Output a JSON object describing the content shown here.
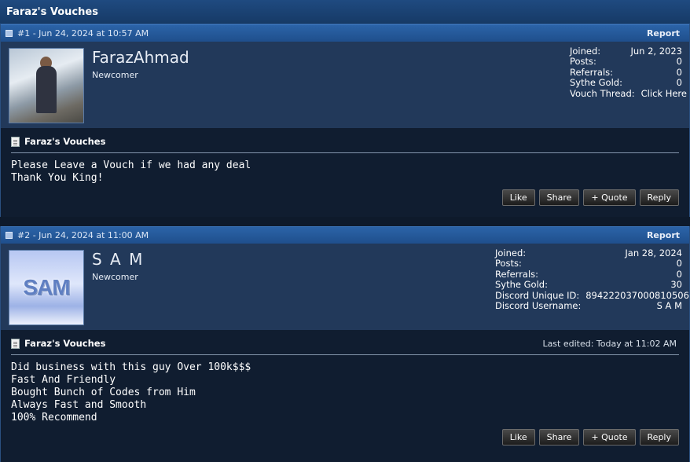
{
  "thread": {
    "title": "Faraz's Vouches"
  },
  "posts": [
    {
      "meta": "#1 - Jun 24, 2024 at 10:57 AM",
      "report": "Report",
      "username": "FarazAhmad",
      "rank": "Newcomer",
      "stats": [
        {
          "k": "Joined:",
          "v": "Jun 2, 2023"
        },
        {
          "k": "Posts:",
          "v": "0"
        },
        {
          "k": "Referrals:",
          "v": "0"
        },
        {
          "k": "Sythe Gold:",
          "v": "0"
        },
        {
          "k": "Vouch Thread:",
          "v": "Click Here"
        }
      ],
      "content_title": "Faraz's Vouches",
      "edited": "",
      "lines": [
        "Please Leave a Vouch if we had any deal",
        "Thank You King!"
      ],
      "buttons": [
        "Like",
        "Share",
        "+ Quote",
        "Reply"
      ]
    },
    {
      "meta": "#2 - Jun 24, 2024 at 11:00 AM",
      "report": "Report",
      "username": "S A M",
      "rank": "Newcomer",
      "avatar_text": "SAM",
      "stats": [
        {
          "k": "Joined:",
          "v": "Jan 28, 2024"
        },
        {
          "k": "Posts:",
          "v": "0"
        },
        {
          "k": "Referrals:",
          "v": "0"
        },
        {
          "k": "Sythe Gold:",
          "v": "30"
        },
        {
          "k": "Discord Unique ID:",
          "v": "894222037000810506"
        },
        {
          "k": "Discord Username:",
          "v": "S A M"
        }
      ],
      "content_title": "Faraz's Vouches",
      "edited": "Last edited: Today at 11:02 AM",
      "lines": [
        "Did business with this guy Over 100k$$$",
        "Fast And Friendly",
        "Bought Bunch of Codes from Him",
        "Always Fast and Smooth",
        "100% Recommend"
      ],
      "buttons": [
        "Like",
        "Share",
        "+ Quote",
        "Reply"
      ]
    }
  ]
}
